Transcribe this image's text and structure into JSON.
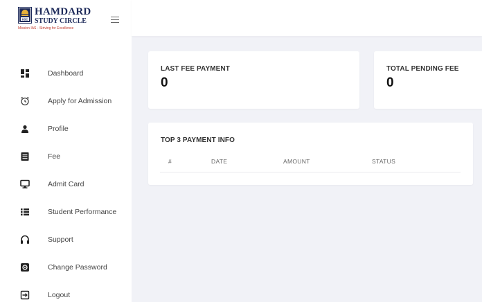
{
  "brand": {
    "line1": "HAMDARD",
    "line2": "STUDY CIRCLE",
    "tagline": "Mission IAS - Striving for Excellence",
    "logo_letters": "HSC"
  },
  "sidebar": {
    "items": [
      {
        "label": "Dashboard",
        "icon": "dashboard-icon"
      },
      {
        "label": "Apply for Admission",
        "icon": "alarm-clock-icon"
      },
      {
        "label": "Profile",
        "icon": "user-icon"
      },
      {
        "label": "Fee",
        "icon": "fee-document-icon"
      },
      {
        "label": "Admit Card",
        "icon": "monitor-icon"
      },
      {
        "label": "Student Performance",
        "icon": "list-icon"
      },
      {
        "label": "Support",
        "icon": "headphones-icon"
      },
      {
        "label": "Change Password",
        "icon": "gear-icon"
      },
      {
        "label": "Logout",
        "icon": "logout-icon"
      }
    ]
  },
  "cards": {
    "last_fee": {
      "title": "LAST FEE PAYMENT",
      "value": "0"
    },
    "pending_fee": {
      "title": "TOTAL PENDING FEE",
      "value": "0"
    }
  },
  "payments": {
    "title": "TOP 3 PAYMENT INFO",
    "columns": [
      "#",
      "DATE",
      "AMOUNT",
      "STATUS"
    ]
  },
  "colors": {
    "background": "#f1f2f7",
    "surface": "#ffffff",
    "brand_navy": "#1d2a5a",
    "tagline_red": "#c0392b"
  }
}
